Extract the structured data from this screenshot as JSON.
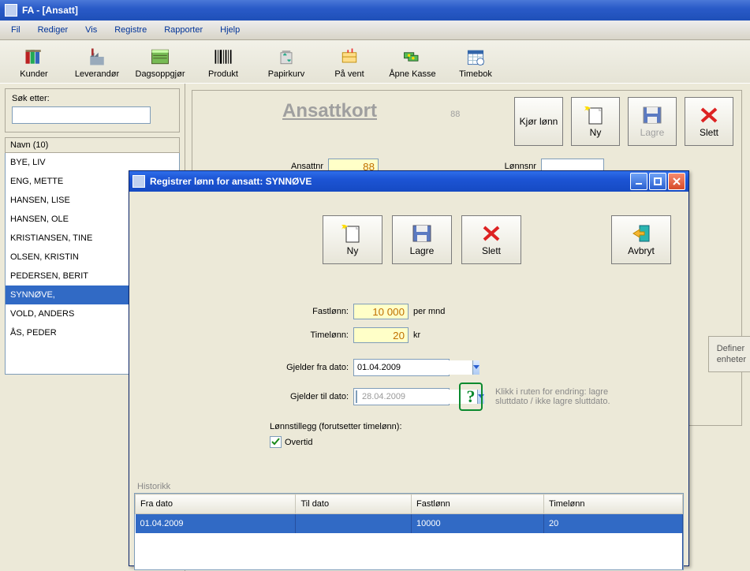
{
  "window": {
    "title": "FA - [Ansatt]"
  },
  "menu": [
    "Fil",
    "Rediger",
    "Vis",
    "Registre",
    "Rapporter",
    "Hjelp"
  ],
  "toolbar": [
    {
      "label": "Kunder",
      "icon": "books-icon"
    },
    {
      "label": "Leverandør",
      "icon": "factory-icon"
    },
    {
      "label": "Dagsoppgjør",
      "icon": "ledger-icon"
    },
    {
      "label": "Produkt",
      "icon": "barcode-icon"
    },
    {
      "label": "Papirkurv",
      "icon": "recycle-icon"
    },
    {
      "label": "På vent",
      "icon": "pending-icon"
    },
    {
      "label": "Åpne Kasse",
      "icon": "cash-icon"
    },
    {
      "label": "Timebok",
      "icon": "calendar-icon"
    }
  ],
  "search_label": "Søk etter:",
  "list_header": "Navn (10)",
  "list": [
    "BYE, LIV",
    "ENG, METTE",
    "HANSEN, LISE",
    "HANSEN, OLE",
    "KRISTIANSEN, TINE",
    "OLSEN, KRISTIN",
    "PEDERSEN, BERIT",
    "SYNNØVE,",
    "VOLD, ANDERS",
    "ÅS, PEDER"
  ],
  "list_selected": "SYNNØVE,",
  "main": {
    "title": "Ansattkort",
    "subid": "88",
    "ansattnr_label": "Ansattnr",
    "ansattnr": "88",
    "lonnsnr_label": "Lønnsnr",
    "lonnsnr": "",
    "btn": {
      "kjor": "Kjør lønn",
      "ny": "Ny",
      "lagre": "Lagre",
      "slett": "Slett"
    },
    "definer": "Definer",
    "enheter": "enheter"
  },
  "dlg": {
    "title": "Registrer lønn for ansatt:  SYNNØVE",
    "btn": {
      "ny": "Ny",
      "lagre": "Lagre",
      "slett": "Slett",
      "avbryt": "Avbryt"
    },
    "fastlonn_label": "Fastlønn:",
    "fastlonn": "10 000",
    "fastlonn_unit": "per mnd",
    "timelonn_label": "Timelønn:",
    "timelonn": "20",
    "timelonn_unit": "kr",
    "fra_label": "Gjelder fra dato:",
    "fra": "01.04.2009",
    "til_label": "Gjelder til dato:",
    "til": "28.04.2009",
    "hint": "Klikk i ruten for endring: lagre sluttdato / ikke lagre sluttdato.",
    "tillegg_label": "Lønnstillegg (forutsetter timelønn):",
    "overtid": "Overtid",
    "hist_label": "Historikk",
    "cols": [
      "Fra dato",
      "Til dato",
      "Fastlønn",
      "Timelønn"
    ],
    "rows": [
      {
        "fra": "01.04.2009",
        "til": "",
        "fast": "10000",
        "time": "20"
      }
    ]
  }
}
